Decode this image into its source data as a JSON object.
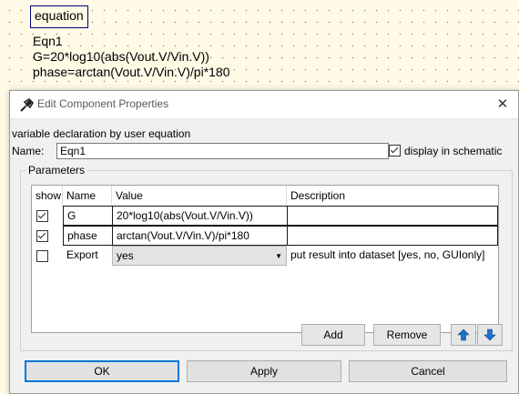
{
  "schematic": {
    "tag": "equation",
    "lines": [
      "Eqn1",
      "G=20*log10(abs(Vout.V/Vin.V))",
      "phase=arctan(Vout.V/Vin.V)/pi*180"
    ]
  },
  "dialog": {
    "title": "Edit Component Properties",
    "close_glyph": "✕",
    "description": "variable declaration by user equation",
    "name_label": "Name:",
    "name_value": "Eqn1",
    "display_checked": true,
    "display_label": "display in schematic",
    "group_title": "Parameters",
    "table": {
      "headers": [
        "show",
        "Name",
        "Value",
        "Description"
      ],
      "rows": [
        {
          "show": true,
          "name": "G",
          "value": "20*log10(abs(Vout.V/Vin.V))",
          "description": ""
        },
        {
          "show": true,
          "name": "phase",
          "value": "arctan(Vout.V/Vin.V)/pi*180",
          "description": ""
        },
        {
          "show": false,
          "name": "Export",
          "value": "yes",
          "description": "put result into dataset [yes, no, GUIonly]"
        }
      ],
      "dropdown_arrow": "▼"
    },
    "buttons": {
      "add": "Add",
      "remove": "Remove",
      "ok": "OK",
      "apply": "Apply",
      "cancel": "Cancel"
    },
    "colors": {
      "accent": "#0078d7",
      "arrow_blue": "#1e72c8"
    }
  }
}
